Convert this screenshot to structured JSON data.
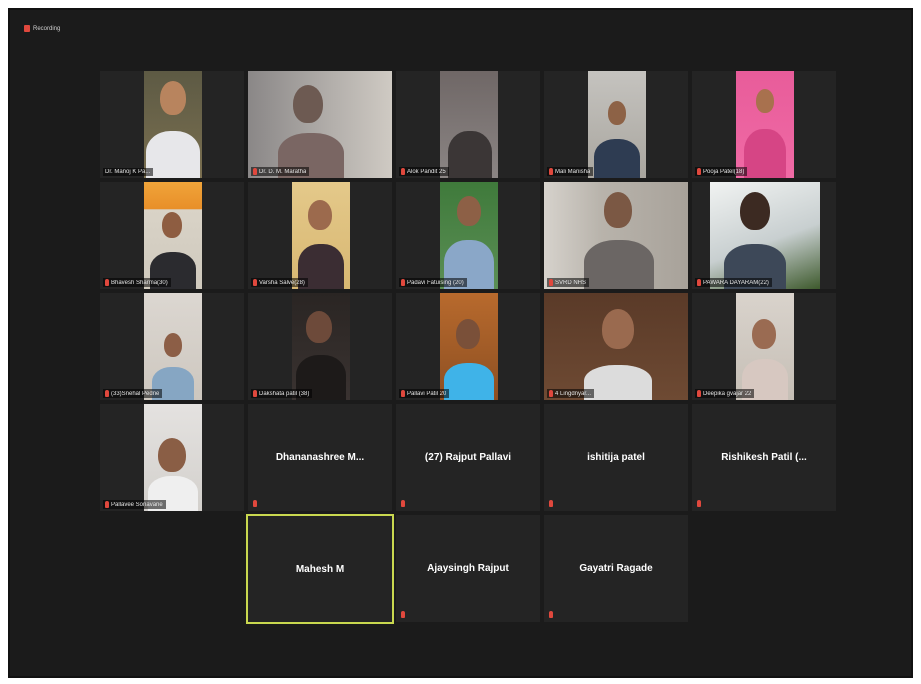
{
  "recording": {
    "label": "Recording"
  },
  "participants": {
    "p1": {
      "name": "Dr. Manoj K Pa..."
    },
    "p2": {
      "name": "Dr. D. M. Maratha"
    },
    "p3": {
      "name": "Alok Pandit 25"
    },
    "p4": {
      "name": "Mali Manisha"
    },
    "p5": {
      "name": "Pooja Patel(18)"
    },
    "p6": {
      "name": "Bhavesh Sharma(30)"
    },
    "p7": {
      "name": "Varsha Salve(28)"
    },
    "p8": {
      "name": "Padavi Fatuising (20)"
    },
    "p9": {
      "name": "SVRD NHS"
    },
    "p10": {
      "name": "PAWARA DAYARAM(22)"
    },
    "p11": {
      "name": "(33)Snehal Pedne"
    },
    "p12": {
      "name": "Dakshata patil (38)"
    },
    "p13": {
      "name": "Pallavi Patil 20"
    },
    "p14": {
      "name": "4 Lingdnyar..."
    },
    "p15": {
      "name": "Deepika gvajar 22"
    },
    "p16": {
      "name": "Pallavee Sonavane"
    },
    "p17": {
      "name": "Dhananashree  M..."
    },
    "p18": {
      "name": "(27) Rajput Pallavi"
    },
    "p19": {
      "name": "ishitija patel"
    },
    "p20": {
      "name": "Rishikesh  Patil  (..."
    },
    "p21": {
      "name": "Mahesh M"
    },
    "p22": {
      "name": "Ajaysingh Rajput"
    },
    "p23": {
      "name": "Gayatri Ragade"
    }
  },
  "colors": {
    "background": "#1b1b1b",
    "tile": "#242424",
    "mic_muted": "#e0483d",
    "active_speaker": "#c9d84f"
  }
}
